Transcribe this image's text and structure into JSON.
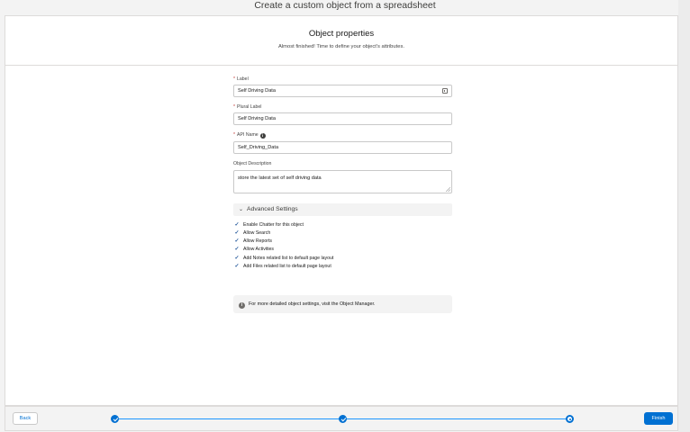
{
  "page": {
    "title": "Create a custom object from a spreadsheet"
  },
  "card": {
    "title": "Object properties",
    "subtitle": "Almost finished! Time to define your object's attributes."
  },
  "form": {
    "label": {
      "label": "Label",
      "value": "Self Driving Data",
      "required": "*"
    },
    "plural_label": {
      "label": "Plural Label",
      "value": "Self Driving Data",
      "required": "*"
    },
    "api_name": {
      "label": "API Name",
      "value": "Self_Driving_Data",
      "required": "*",
      "info_icon": "i"
    },
    "description": {
      "label": "Object Description",
      "value": "store the latest set of self driving data"
    }
  },
  "advanced": {
    "title": "Advanced Settings",
    "chevron": "⌄",
    "check_glyph": "✓",
    "options": [
      "Enable Chatter for this object",
      "Allow Search",
      "Allow Reports",
      "Allow Activities",
      "Add Notes related list to default page layout",
      "Add Files related list to default page layout"
    ]
  },
  "info_box": {
    "icon": "i",
    "text": "For more detailed object settings, visit the Object Manager."
  },
  "footer": {
    "back_label": "Back",
    "finish_label": "Finish"
  }
}
